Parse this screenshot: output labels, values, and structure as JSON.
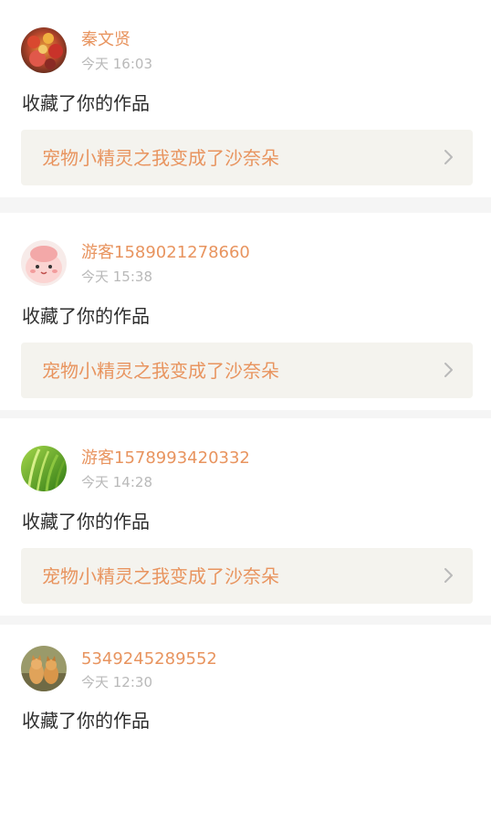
{
  "notifications": [
    {
      "username": "秦文贤",
      "time": "今天 16:03",
      "action": "收藏了你的作品",
      "work_title": "宠物小精灵之我变成了沙奈朵",
      "avatar_icon": "autumn-leaves-avatar-icon"
    },
    {
      "username": "游客1589021278660",
      "time": "今天 15:38",
      "action": "收藏了你的作品",
      "work_title": "宠物小精灵之我变成了沙奈朵",
      "avatar_icon": "pink-cartoon-avatar-icon"
    },
    {
      "username": "游客1578993420332",
      "time": "今天 14:28",
      "action": "收藏了你的作品",
      "work_title": "宠物小精灵之我变成了沙奈朵",
      "avatar_icon": "green-grass-avatar-icon"
    },
    {
      "username": "5349245289552",
      "time": "今天 12:30",
      "action": "收藏了你的作品",
      "work_title": "",
      "avatar_icon": "cats-avatar-icon"
    }
  ],
  "colors": {
    "username": "#e8945f",
    "work_title": "#e8945f",
    "timestamp": "#b9b9b9",
    "action_text": "#2e2e2e",
    "link_background": "#f4f3ee",
    "page_background": "#f5f5f5"
  }
}
